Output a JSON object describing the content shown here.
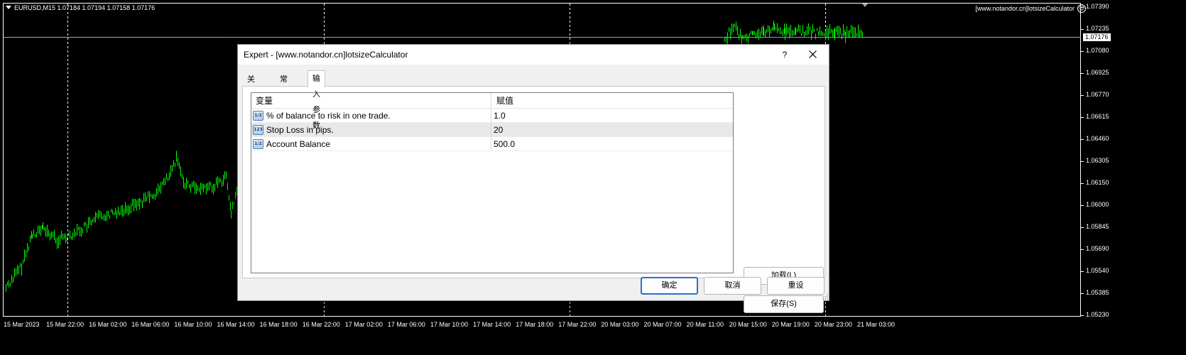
{
  "chart": {
    "symbol_line": "EURUSD,M15  1.07184 1.07194 1.07158 1.07176",
    "ea_label": "[www.notandor.cn]lotsizeCalculator",
    "current_price": "1.07176",
    "price_labels": [
      "1.07390",
      "1.07235",
      "1.07080",
      "1.06925",
      "1.06770",
      "1.06615",
      "1.06460",
      "1.06305",
      "1.06150",
      "1.06000",
      "1.05845",
      "1.05690",
      "1.05540",
      "1.05385",
      "1.05230"
    ],
    "time_labels": [
      "15 Mar 2023",
      "15 Mar 22:00",
      "16 Mar 02:00",
      "16 Mar 06:00",
      "16 Mar 10:00",
      "16 Mar 14:00",
      "16 Mar 18:00",
      "16 Mar 22:00",
      "17 Mar 02:00",
      "17 Mar 06:00",
      "17 Mar 10:00",
      "17 Mar 14:00",
      "17 Mar 18:00",
      "17 Mar 22:00",
      "20 Mar 03:00",
      "20 Mar 07:00",
      "20 Mar 11:00",
      "20 Mar 15:00",
      "20 Mar 19:00",
      "20 Mar 23:00",
      "21 Mar 03:00"
    ],
    "colors": {
      "candles": "#00ff00",
      "grid": "#ffffff",
      "price_line": "#8fa8c8"
    }
  },
  "dialog": {
    "title": "Expert - [www.notandor.cn]lotsizeCalculator",
    "help_label": "?",
    "tabs": [
      {
        "label": "关于",
        "active": false
      },
      {
        "label": "常用",
        "active": false
      },
      {
        "label": "输入参数",
        "active": true
      }
    ],
    "table": {
      "col_variable": "变量",
      "col_value": "赋值",
      "rows": [
        {
          "icon": "double-type-icon",
          "icon_text": "1/2",
          "name": "% of balance to risk in one trade.",
          "value": "1.0"
        },
        {
          "icon": "integer-type-icon",
          "icon_text": "123",
          "name": "Stop Loss in pips.",
          "value": "20"
        },
        {
          "icon": "double-type-icon",
          "icon_text": "1/2",
          "name": "Account Balance",
          "value": "500.0"
        }
      ]
    },
    "buttons": {
      "load": "加载(L)",
      "save": "保存(S)",
      "ok": "确定",
      "cancel": "取消",
      "reset": "重设"
    }
  }
}
